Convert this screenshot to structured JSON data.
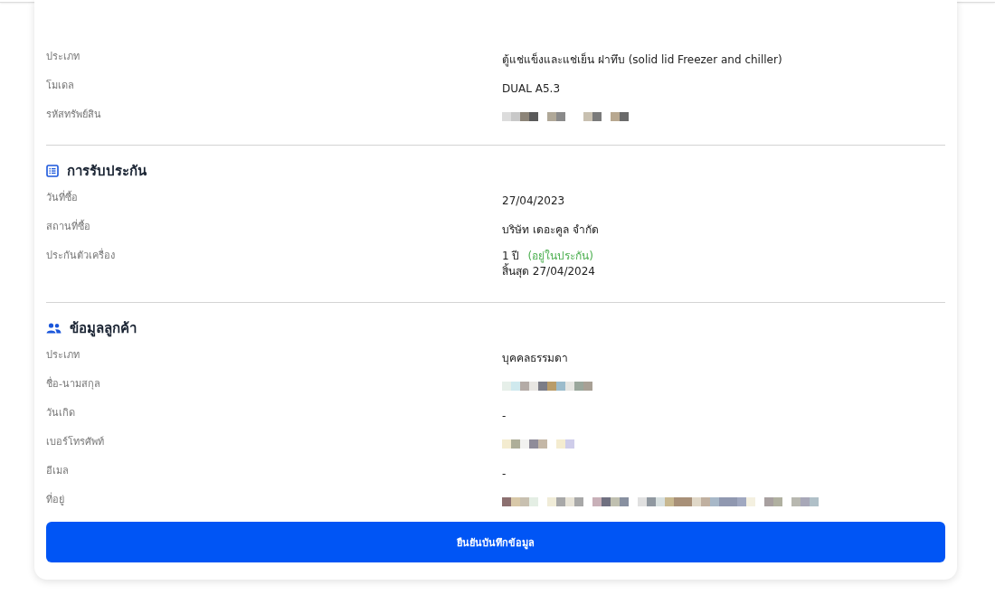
{
  "product": {
    "rows": [
      {
        "label": "ประเภท",
        "kind": "text",
        "value": "ตู้แช่แข็งและแช่เย็น ฝาทึบ (solid lid Freezer and chiller)"
      },
      {
        "label": "โมเดล",
        "kind": "text",
        "value": "DUAL A5.3"
      },
      {
        "label": "รหัสทรัพย์สิน",
        "kind": "redacted"
      }
    ]
  },
  "warranty": {
    "title": "การรับประกัน",
    "rows": [
      {
        "label": "วันที่ซื้อ",
        "kind": "text",
        "value": "27/04/2023"
      },
      {
        "label": "สถานที่ซื้อ",
        "kind": "text",
        "value": "บริษัท เดอะคูล จำกัด"
      },
      {
        "label": "ประกันตัวเครื่อง",
        "kind": "warranty",
        "value": "1 ปี",
        "status": "(อยู่ในประกัน)",
        "end": "สิ้นสุด 27/04/2024"
      }
    ]
  },
  "customer": {
    "title": "ข้อมูลลูกค้า",
    "rows": [
      {
        "label": "ประเภท",
        "kind": "text",
        "value": "บุคคลธรรมดา"
      },
      {
        "label": "ชื่อ-นามสกุล",
        "kind": "redacted"
      },
      {
        "label": "วันเกิด",
        "kind": "text",
        "value": "-"
      },
      {
        "label": "เบอร์โทรศัพท์",
        "kind": "redacted"
      },
      {
        "label": "อีเมล",
        "kind": "text",
        "value": "-"
      },
      {
        "label": "ที่อยู่",
        "kind": "redacted"
      }
    ]
  },
  "confirm_button": {
    "label": "ยืนยันบันทึกข้อมูล"
  }
}
